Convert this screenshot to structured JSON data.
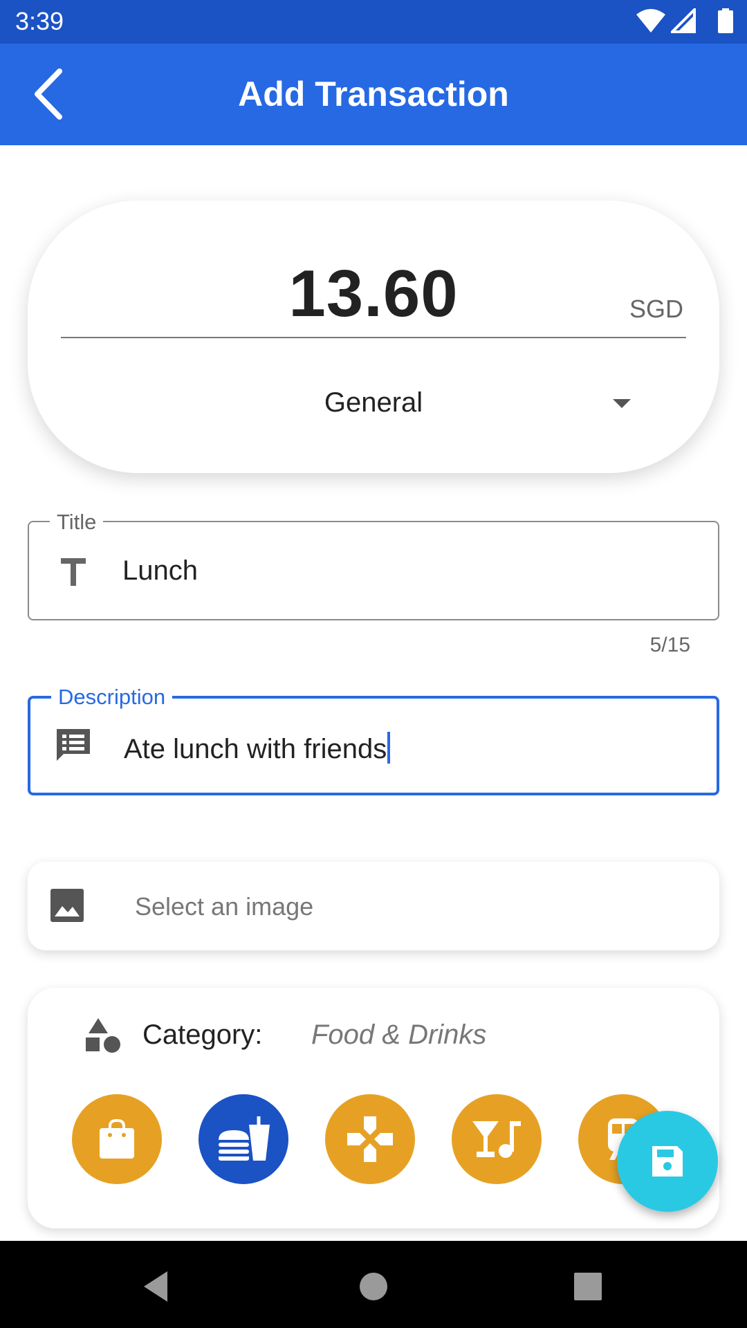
{
  "status_bar": {
    "time": "3:39"
  },
  "app_bar": {
    "title": "Add Transaction"
  },
  "amount": {
    "value": "13.60",
    "currency": "SGD",
    "account": "General"
  },
  "title_field": {
    "label": "Title",
    "value": "Lunch",
    "counter": "5/15"
  },
  "description_field": {
    "label": "Description",
    "value": "Ate lunch with friends"
  },
  "image_selector": {
    "label": "Select an image"
  },
  "category": {
    "label": "Category:",
    "selected": "Food & Drinks",
    "options": [
      "shopping-bag-icon",
      "fastfood-icon",
      "gamepad-icon",
      "nightlife-icon",
      "train-icon"
    ]
  },
  "colors": {
    "primary": "#2669e3",
    "status_bar": "#1b52c4",
    "category_default": "#e6a124",
    "category_selected": "#1b52c4",
    "fab": "#29c9e3"
  }
}
